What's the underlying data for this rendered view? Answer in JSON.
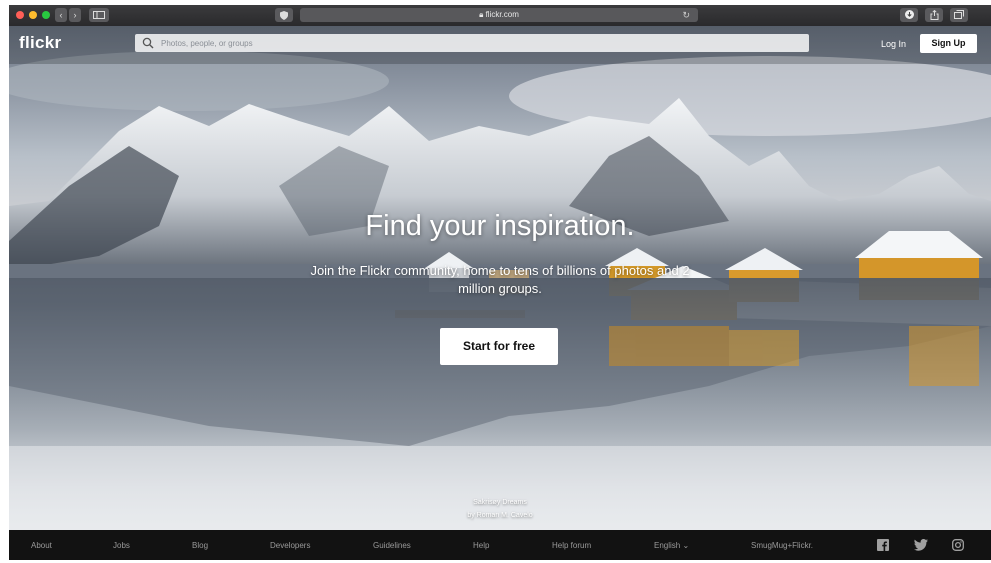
{
  "browser": {
    "url": "flickr.com",
    "reload_glyph": "↻",
    "back_glyph": "‹",
    "forward_glyph": "›",
    "colors": {
      "close": "#ff5f57",
      "minimize": "#febc2e",
      "zoom": "#28c840"
    }
  },
  "header": {
    "logo": "flickr",
    "search_placeholder": "Photos, people, or groups",
    "login_label": "Log In",
    "signup_label": "Sign Up"
  },
  "hero": {
    "headline": "Find your inspiration.",
    "subheadline": "Join the Flickr community, home to tens of billions of photos and 2 million groups.",
    "cta_label": "Start for free",
    "photo_title": "Sakrisøy Dreams",
    "photo_author": "by Roman M. Cavelo"
  },
  "footer": {
    "links": [
      "About",
      "Jobs",
      "Blog",
      "Developers",
      "Guidelines",
      "Help",
      "Help forum"
    ],
    "language": "English ⌄",
    "company": "SmugMug+Flickr.",
    "social_icons": [
      "facebook-icon",
      "twitter-icon",
      "instagram-icon"
    ]
  },
  "colors": {
    "footer_bg": "#121212",
    "house_yellow": "#d59a2a",
    "button_bg": "#ffffff"
  }
}
